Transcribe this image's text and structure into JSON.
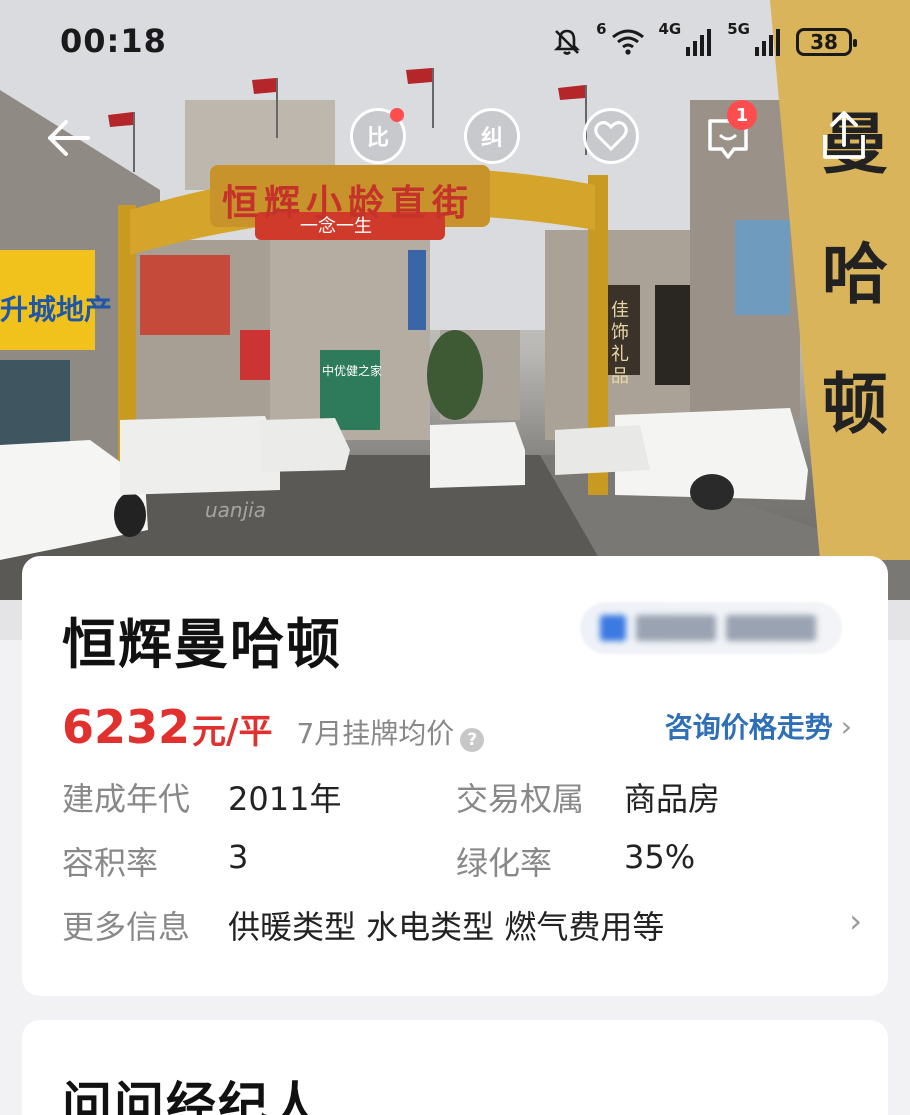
{
  "status_bar": {
    "time": "00:18",
    "wifi_label": "6",
    "net1_label": "4G",
    "net2_label": "5G",
    "battery": "38"
  },
  "photo": {
    "arch_sign": "恒辉小龄直街",
    "arch_sub": "一念一生",
    "left_shop": "升城地产",
    "right_shop_1": "佳饰礼品",
    "right_pillar": "曼哈顿",
    "center_sign": "中优健之家",
    "watermark": "uanjia"
  },
  "top_nav": {
    "compare_label": "比",
    "correct_label": "纠",
    "message_badge": "1"
  },
  "community": {
    "name": "恒辉曼哈顿",
    "price": "6232",
    "price_unit": "元/平",
    "price_note": "7月挂牌均价",
    "price_help": "?",
    "trend_link": "咨询价格走势",
    "fields": [
      {
        "k": "建成年代",
        "v": "2011年",
        "k2": "交易权属",
        "v2": "商品房"
      },
      {
        "k": "容积率",
        "v": "3",
        "k2": "绿化率",
        "v2": "35%"
      }
    ],
    "more_label": "更多信息",
    "more_value": "供暖类型 水电类型 燃气费用等"
  },
  "agent_section": {
    "title": "问问经纪人"
  },
  "colors": {
    "price_red": "#e0312f",
    "link_blue": "#2e6fb7",
    "badge_red": "#ff4d4f"
  }
}
